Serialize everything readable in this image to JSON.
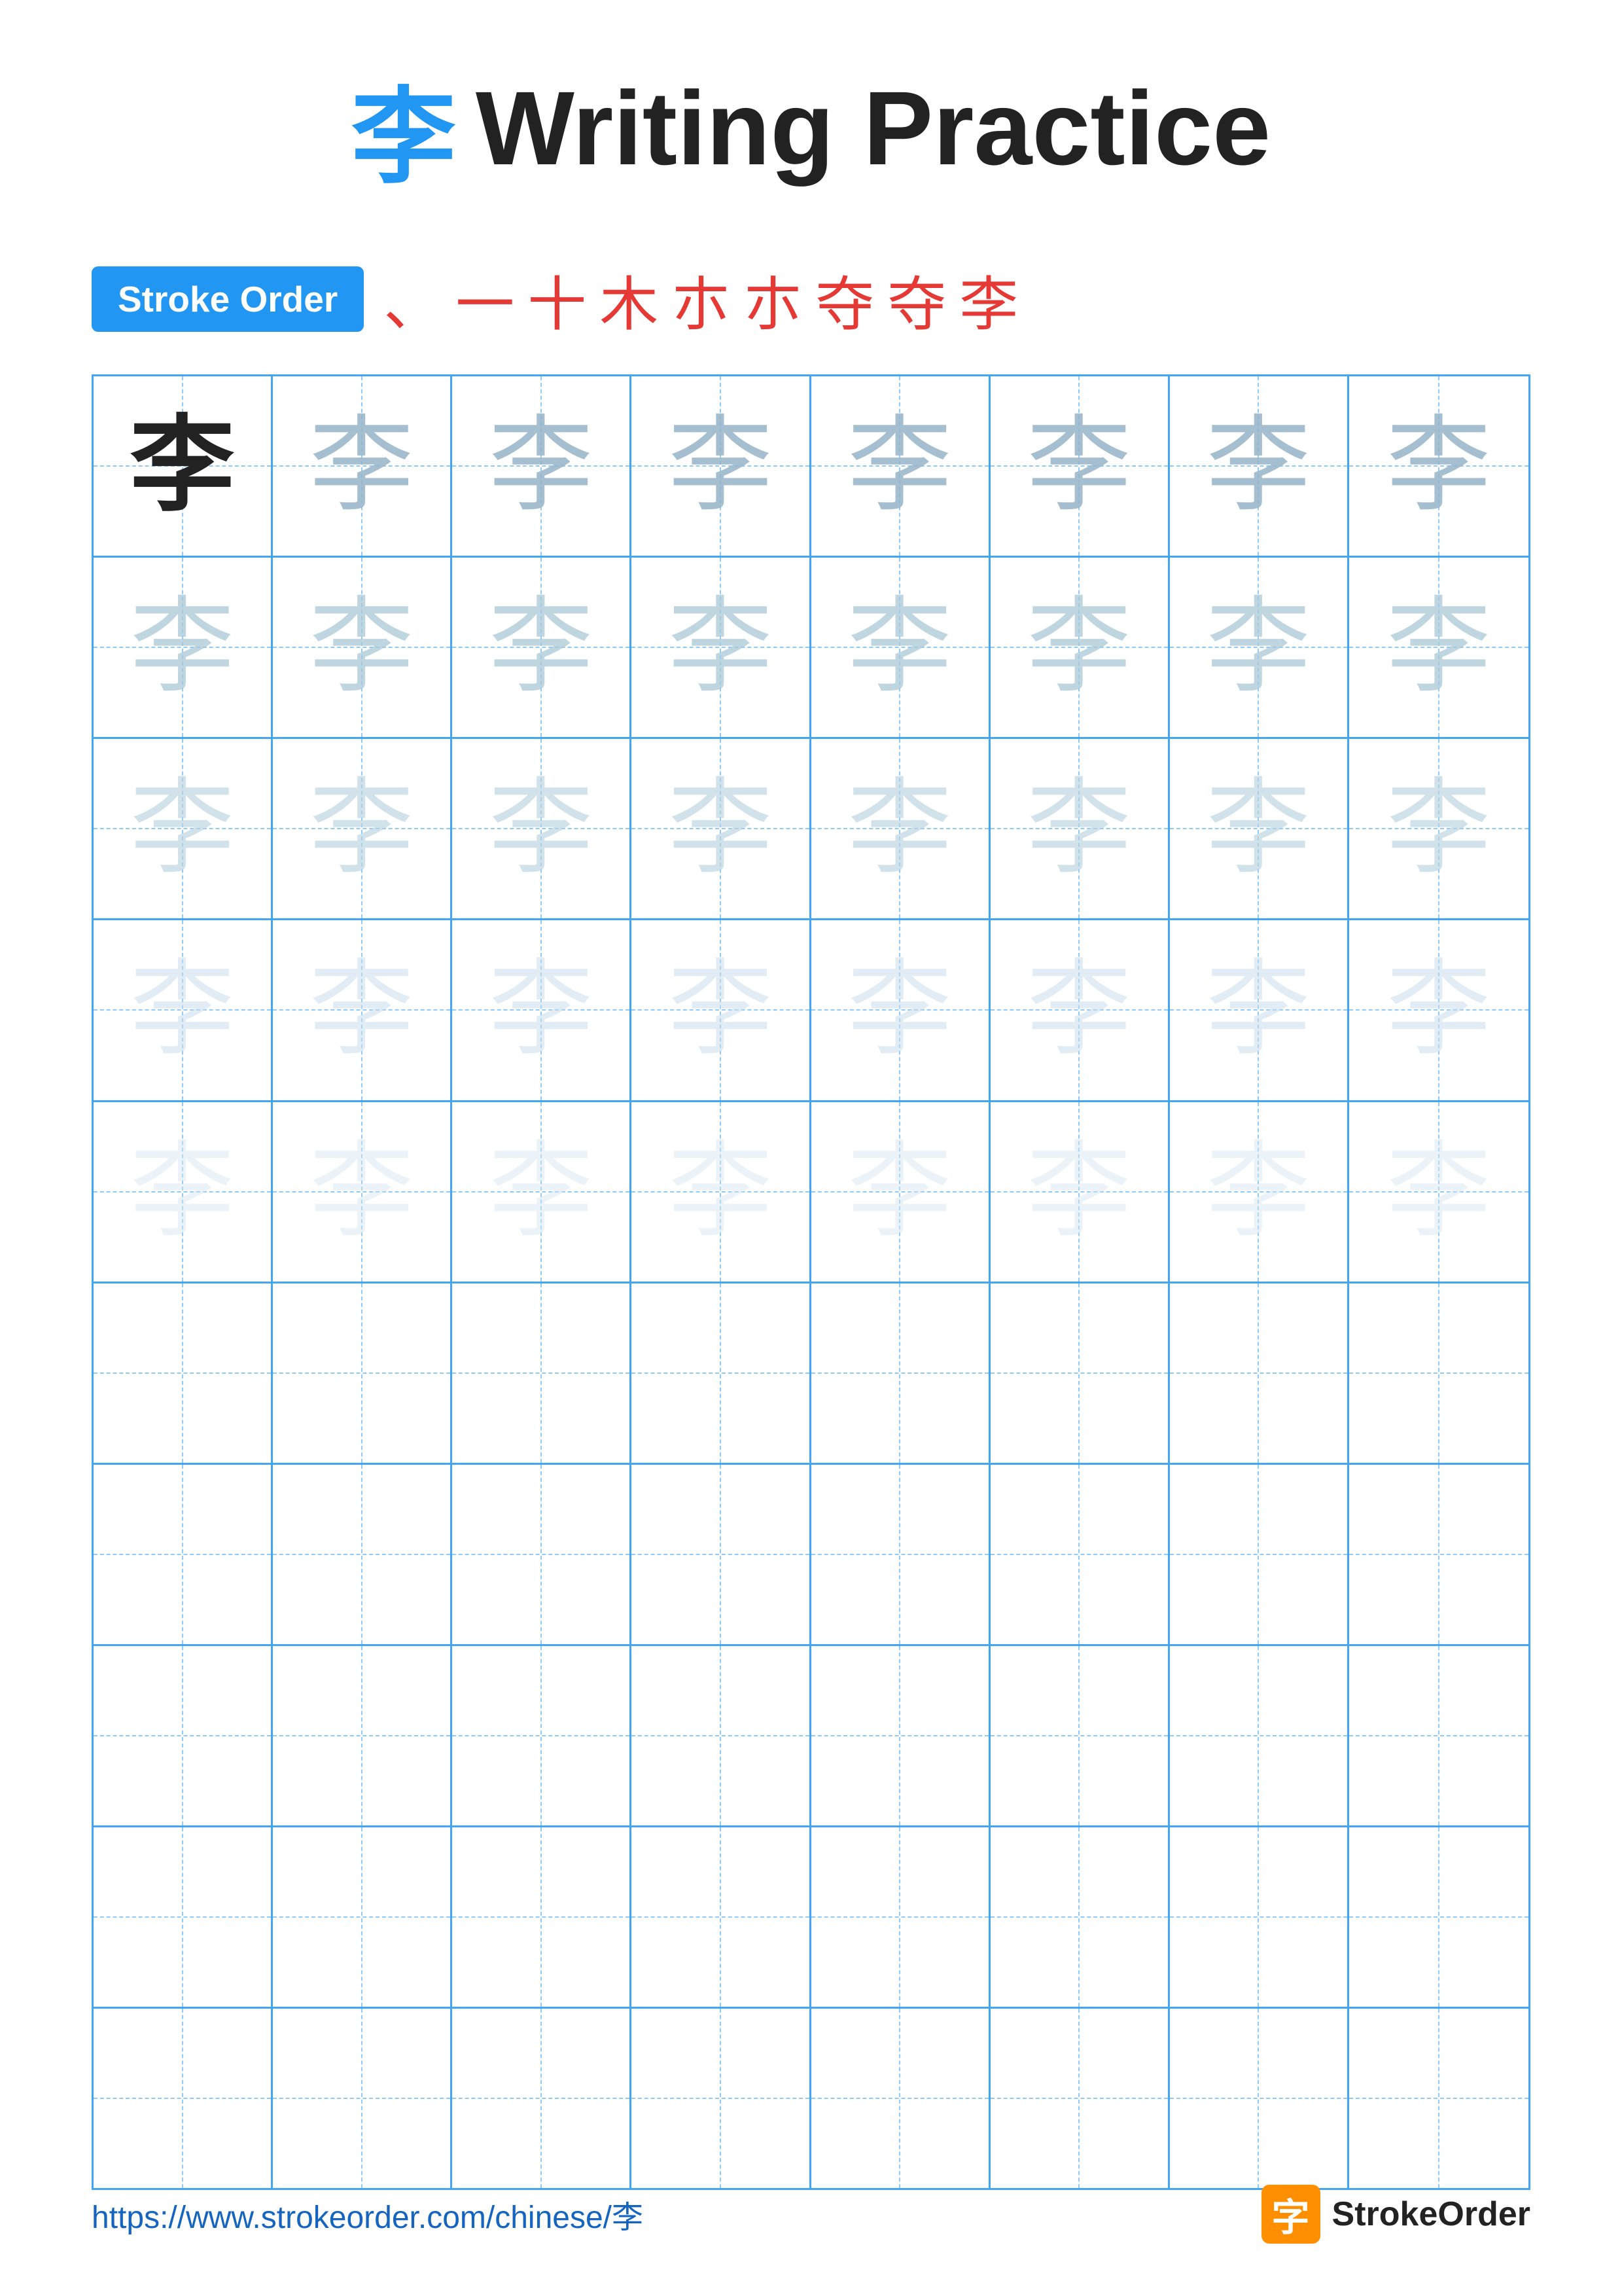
{
  "page": {
    "title": {
      "char": "李",
      "text": " Writing Practice"
    },
    "stroke_order": {
      "badge_label": "Stroke Order",
      "strokes": [
        "、",
        "一",
        "十",
        "木",
        "朩",
        "朩",
        "夺",
        "夺",
        "李"
      ]
    },
    "grid": {
      "rows": 10,
      "cols": 8,
      "practice_char": "李",
      "filled_rows": 5,
      "empty_rows": 5
    },
    "footer": {
      "url": "https://www.strokeorder.com/chinese/李",
      "brand_char": "字",
      "brand_name": "StrokeOrder"
    }
  }
}
